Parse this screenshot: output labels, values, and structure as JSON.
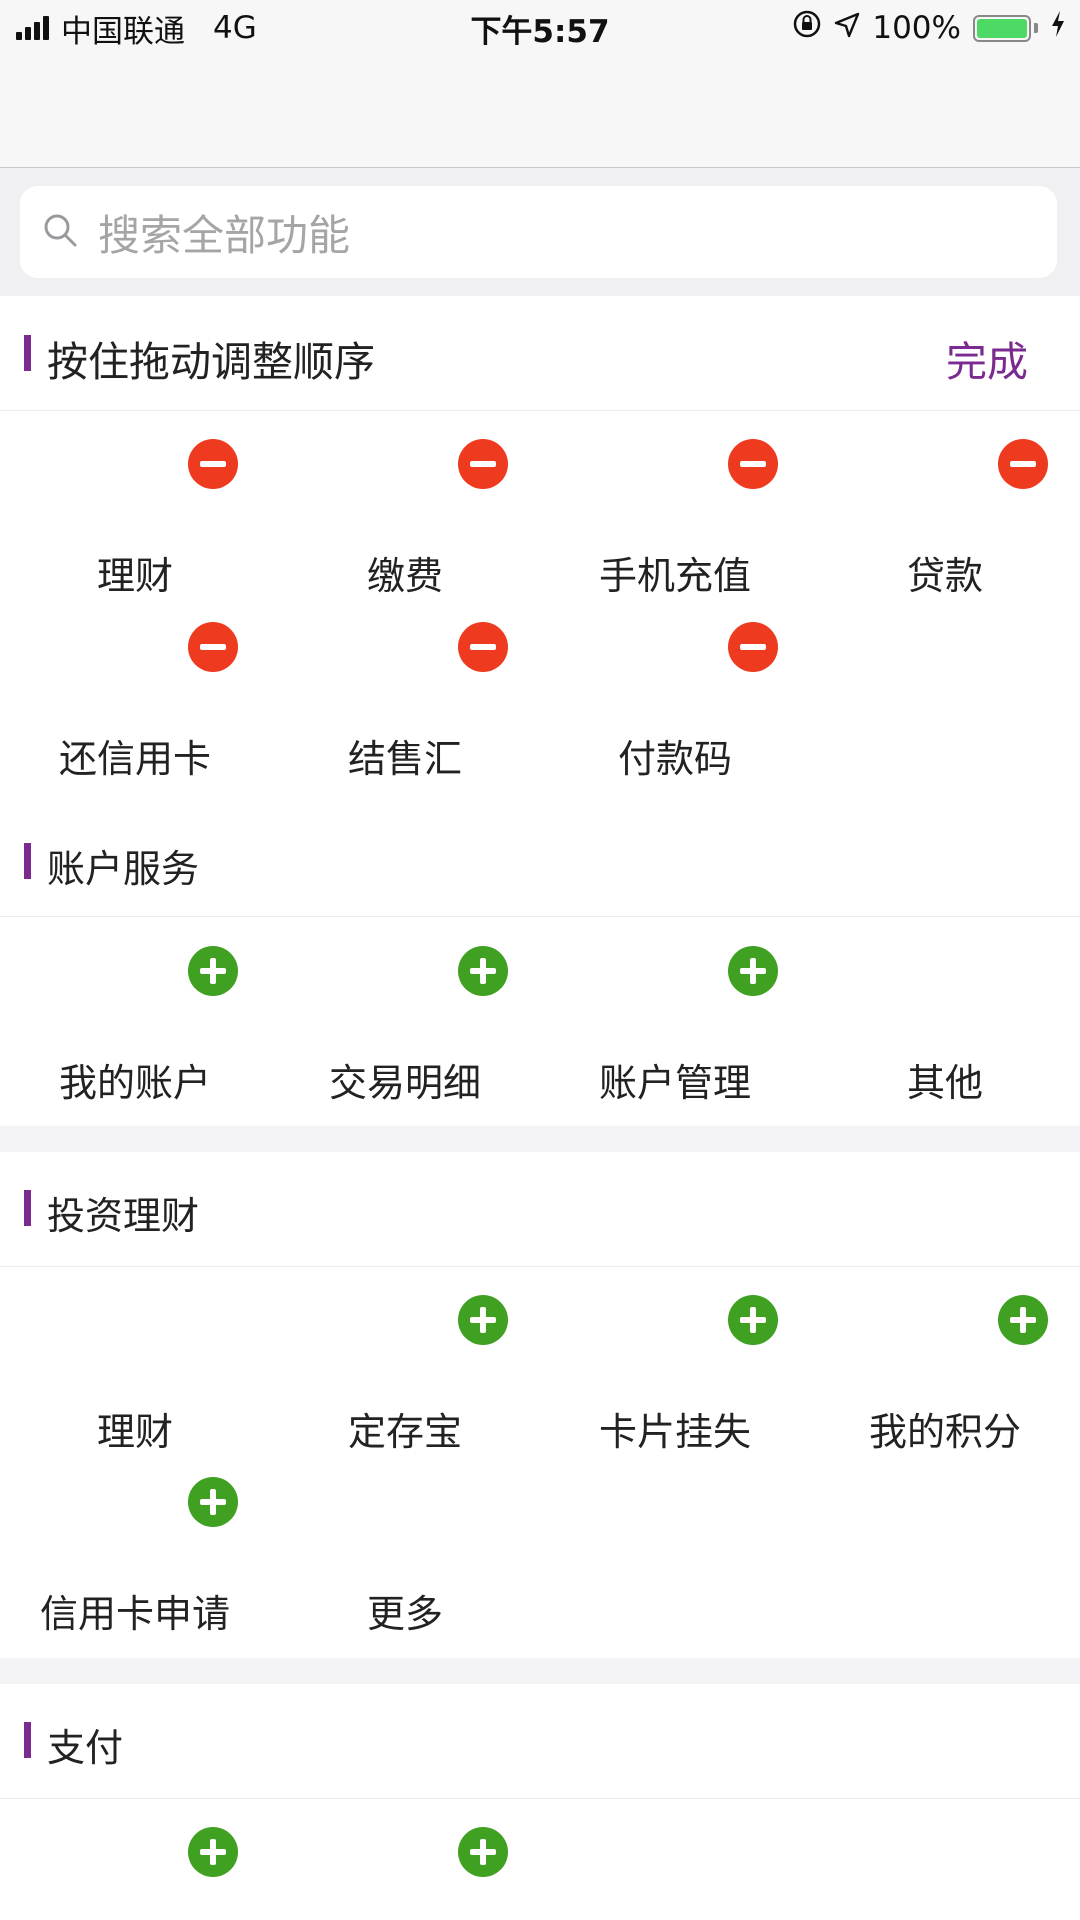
{
  "status_bar": {
    "carrier": "中国联通",
    "network": "4G",
    "time": "下午5:57",
    "battery_percent": "100%",
    "icons": [
      "signal-icon",
      "orientation-lock-icon",
      "location-icon",
      "battery-icon",
      "charging-icon"
    ]
  },
  "search": {
    "placeholder": "搜索全部功能",
    "icon": "search-icon"
  },
  "edit_section": {
    "title": "按住拖动调整顺序",
    "done_label": "完成",
    "items": [
      {
        "label": "理财",
        "action": "remove"
      },
      {
        "label": "缴费",
        "action": "remove"
      },
      {
        "label": "手机充值",
        "action": "remove"
      },
      {
        "label": "贷款",
        "action": "remove"
      },
      {
        "label": "还信用卡",
        "action": "remove"
      },
      {
        "label": "结售汇",
        "action": "remove"
      },
      {
        "label": "付款码",
        "action": "remove"
      }
    ]
  },
  "account_section": {
    "title": "账户服务",
    "items": [
      {
        "label": "我的账户",
        "action": "add"
      },
      {
        "label": "交易明细",
        "action": "add"
      },
      {
        "label": "账户管理",
        "action": "add"
      },
      {
        "label": "其他",
        "action": "none"
      }
    ]
  },
  "invest_section": {
    "title": "投资理财",
    "items": [
      {
        "label": "理财",
        "action": "none"
      },
      {
        "label": "定存宝",
        "action": "add"
      },
      {
        "label": "卡片挂失",
        "action": "add"
      },
      {
        "label": "我的积分",
        "action": "add"
      },
      {
        "label": "信用卡申请",
        "action": "add"
      },
      {
        "label": "更多",
        "action": "none"
      }
    ]
  },
  "pay_section": {
    "title": "支付",
    "items": [
      {
        "label": "",
        "action": "add"
      },
      {
        "label": "",
        "action": "add"
      }
    ]
  },
  "colors": {
    "accent": "#7b2a8f",
    "remove": "#ee3a1e",
    "add": "#3fa021",
    "page_bg": "#f0f0f2"
  }
}
